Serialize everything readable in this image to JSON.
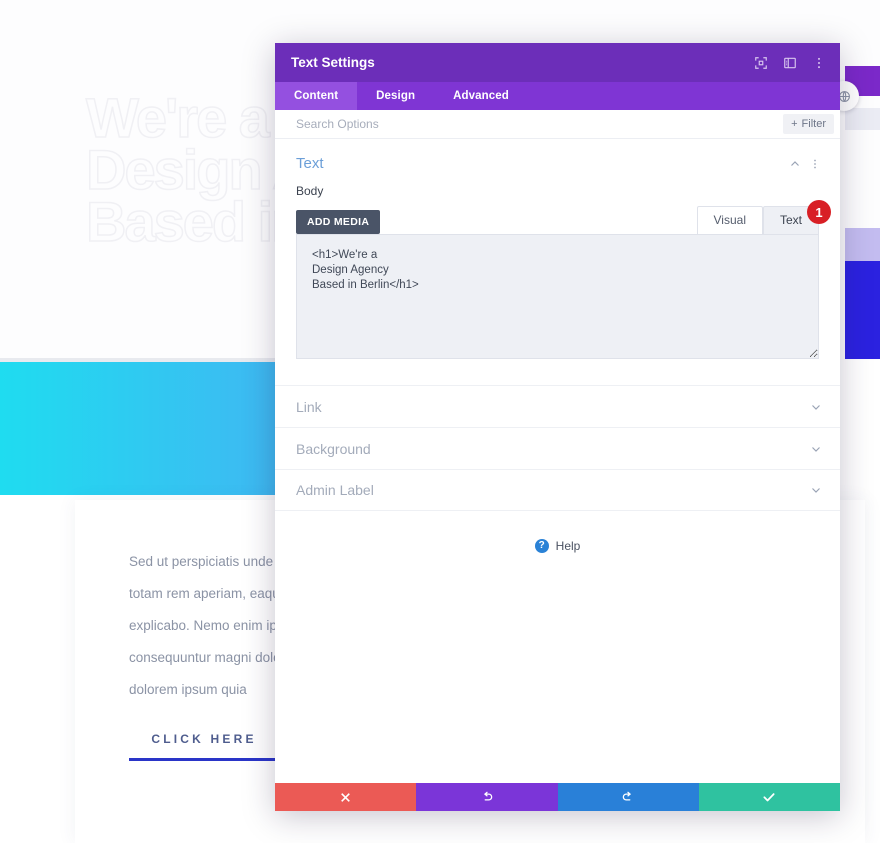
{
  "background": {
    "hero_heading": "We're a\nDesign A\nBased in",
    "body_text": "Sed ut perspiciatis unde\ntotam rem aperiam, eaqu\nexplicabo. Nemo enim ips\nconsequuntur magni dolo\ndolorem ipsum quia",
    "cta_label": "CLICK HERE",
    "round_button_icon": "globe-icon",
    "colors": {
      "band_start": "#1fdcf0",
      "band_end": "#3fb8f2",
      "right_blue": "#2b22e0",
      "right_lavender": "#c3bcf0",
      "cta_rule": "#2a35c8"
    }
  },
  "modal": {
    "title": "Text Settings",
    "titlebar_icons": [
      {
        "name": "expand-icon",
        "label": "Expand"
      },
      {
        "name": "layout-panel-icon",
        "label": "Change Layout"
      },
      {
        "name": "more-vertical-icon",
        "label": "More Options"
      }
    ],
    "tabs": [
      {
        "label": "Content",
        "active": true
      },
      {
        "label": "Design",
        "active": false
      },
      {
        "label": "Advanced",
        "active": false
      }
    ],
    "search": {
      "placeholder": "Search Options",
      "value": ""
    },
    "filter_button": {
      "label": "Filter",
      "plus": "+"
    },
    "section": {
      "title": "Text",
      "collapse_icon": "chevron-up-icon",
      "menu_icon": "more-vertical-icon"
    },
    "body_field": {
      "label": "Body",
      "add_media_label": "ADD MEDIA",
      "editor_tabs": [
        {
          "label": "Visual",
          "active": false
        },
        {
          "label": "Text",
          "active": true
        }
      ],
      "badge": "1",
      "content": "<h1>We're a\nDesign Agency\nBased in Berlin</h1>"
    },
    "collapsed_sections": [
      {
        "label": "Link",
        "icon": "chevron-down-icon"
      },
      {
        "label": "Background",
        "icon": "chevron-down-icon"
      },
      {
        "label": "Admin Label",
        "icon": "chevron-down-icon"
      }
    ],
    "help": {
      "icon_glyph": "?",
      "label": "Help"
    },
    "footer_buttons": [
      {
        "name": "cancel-button",
        "icon": "close-icon",
        "color": "#eb5a55"
      },
      {
        "name": "undo-button",
        "icon": "undo-icon",
        "color": "#7b35d8"
      },
      {
        "name": "redo-button",
        "icon": "redo-icon",
        "color": "#2980d8"
      },
      {
        "name": "save-button",
        "icon": "check-icon",
        "color": "#2fc2a0"
      }
    ]
  }
}
